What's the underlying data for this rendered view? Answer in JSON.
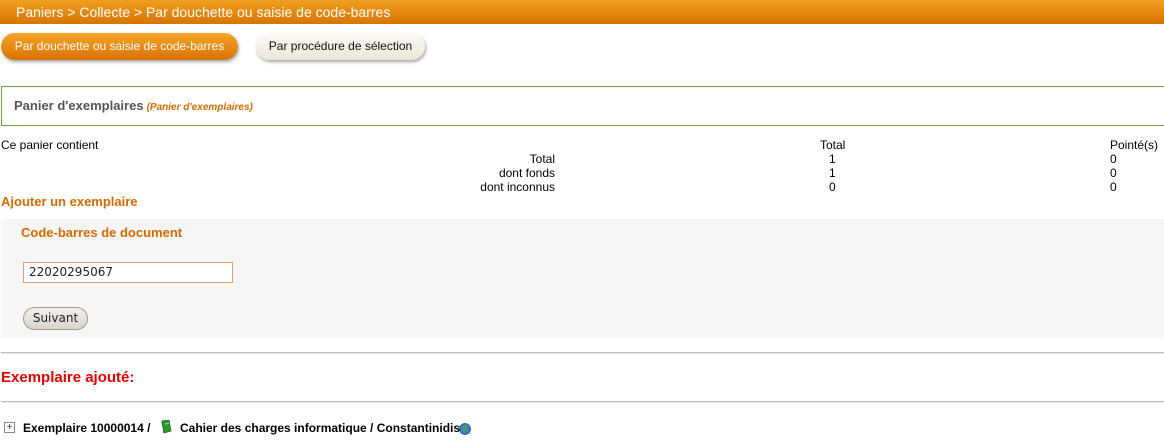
{
  "breadcrumb": "Paniers > Collecte > Par douchette ou saisie de code-barres",
  "tabs": {
    "active": "Par douchette ou saisie de code-barres",
    "inactive": "Par procédure de sélection"
  },
  "panel": {
    "title": "Panier d'exemplaires",
    "subtitle": "(Panier d'exemplaires)"
  },
  "summary": {
    "intro": "Ce panier contient",
    "col_total": "Total",
    "col_pointed": "Pointé(s)",
    "rows": [
      {
        "label": "Total",
        "total": "1",
        "pointed": "0"
      },
      {
        "label": "dont fonds",
        "total": "1",
        "pointed": "0"
      },
      {
        "label": "dont inconnus",
        "total": "0",
        "pointed": "0"
      }
    ]
  },
  "add_section": {
    "link": "Ajouter un exemplaire",
    "field_label": "Code-barres de document",
    "barcode_value": "22020295067",
    "submit": "Suivant"
  },
  "result": {
    "heading": "Exemplaire ajouté:",
    "expand_glyph": "+",
    "item_text": "Exemplaire 10000014 /",
    "record_text": "Cahier des charges informatique / Constantinidis",
    "icons": [
      "book-icon",
      "globe-icon"
    ]
  },
  "colors": {
    "accent": "#d46a00",
    "bar": "#e48a10",
    "alert": "#e00000",
    "panel_border": "#6fa040"
  }
}
